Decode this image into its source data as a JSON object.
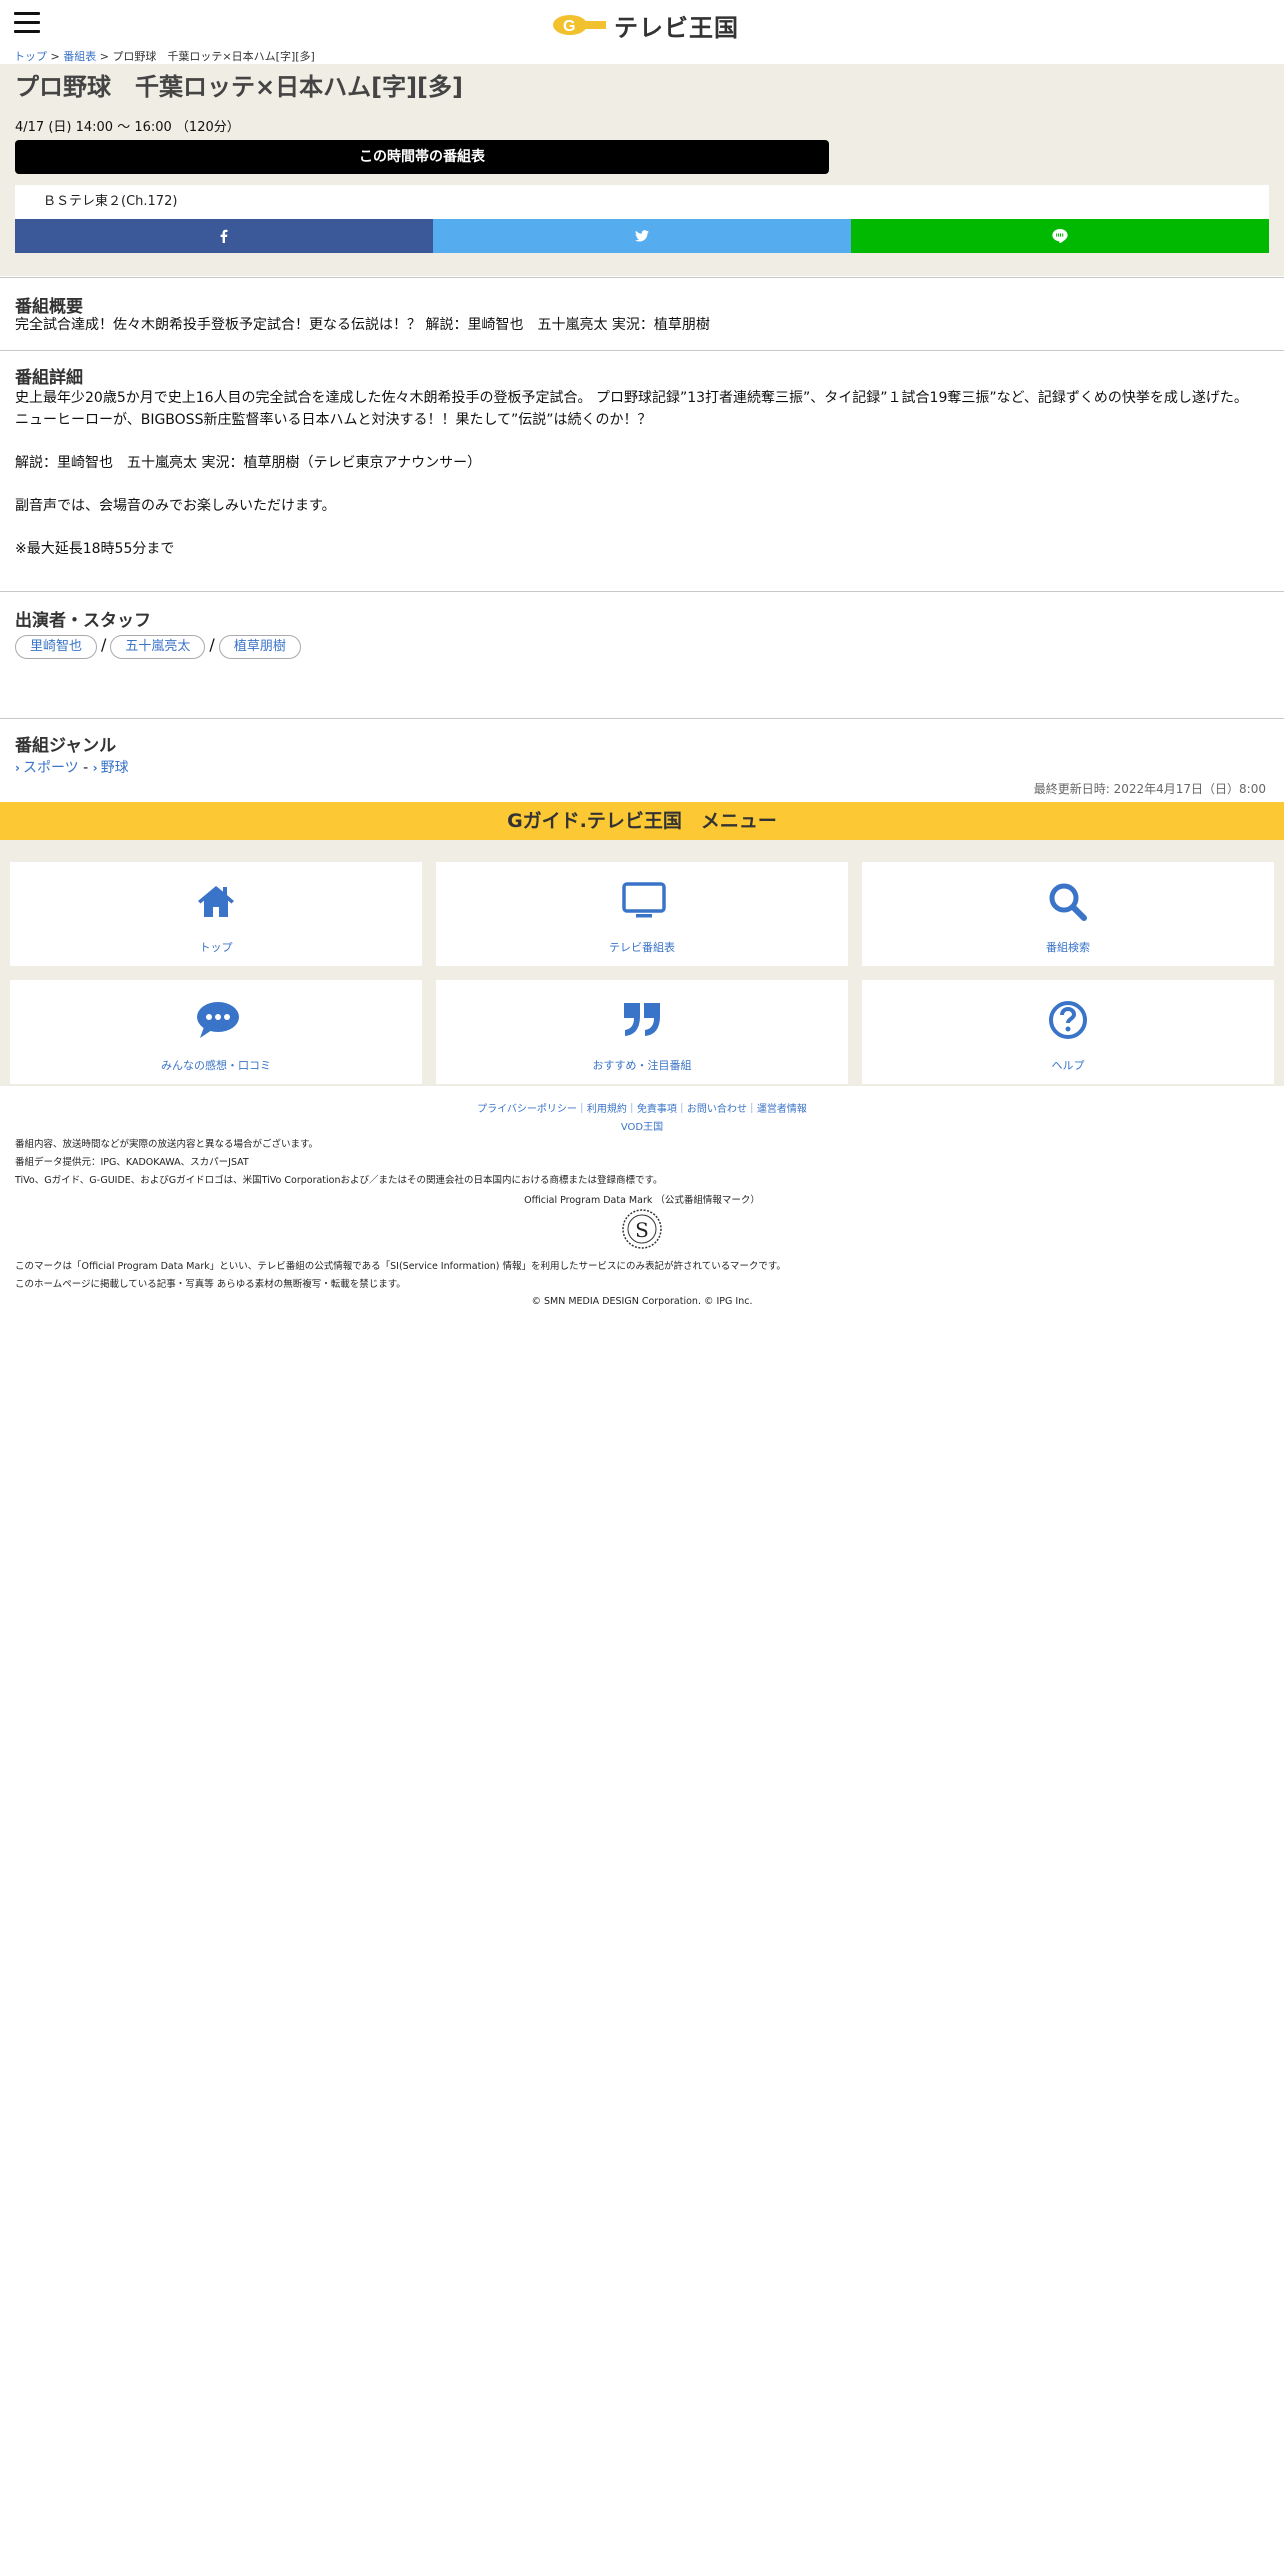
{
  "header": {
    "menu_icon": "hamburger-icon",
    "logo_text": "テレビ王国",
    "logo_mark_text": "G"
  },
  "breadcrumb": {
    "top": "トップ",
    "sep1": " > ",
    "guide": "番組表",
    "sep2": " > ",
    "current": "プロ野球　千葉ロッテ×日本ハム[字][多]"
  },
  "program": {
    "title": "プロ野球　千葉ロッテ×日本ハム[字][多]",
    "datetime": "4/17 (日) 14:00 ～ 16:00 （120分）",
    "timetable_button": "この時間帯の番組表",
    "channel": "ＢＳテレ東２(Ch.172)"
  },
  "share": {
    "facebook_icon": "facebook-icon",
    "twitter_icon": "twitter-icon",
    "line_icon": "line-icon",
    "colors": {
      "facebook": "#3b5998",
      "twitter": "#55acee",
      "line": "#00b900"
    }
  },
  "summary": {
    "heading": "番組概要",
    "text": "完全試合達成！佐々木朗希投手登板予定試合！更なる伝説は！？ 解説：里崎智也　五十嵐亮太 実況：植草朋樹"
  },
  "detail": {
    "heading": "番組詳細",
    "para1": "史上最年少20歳5か月で史上16人目の完全試合を達成した佐々木朗希投手の登板予定試合。 プロ野球記録”13打者連続奪三振”、タイ記録”１試合19奪三振”など、記録ずくめの快挙を成し遂げた。 ニューヒーローが、BIGBOSS新庄監督率いる日本ハムと対決する！！果たして”伝説”は続くのか！？",
    "para2": "解説：里崎智也　五十嵐亮太 実況：植草朋樹（テレビ東京アナウンサー）",
    "para3": "副音声では、会場音のみでお楽しみいただけます。",
    "para4": "※最大延長18時55分まで"
  },
  "cast": {
    "heading": "出演者・スタッフ",
    "sep": "/",
    "people": [
      "里崎智也",
      "五十嵐亮太",
      "植草朋樹"
    ]
  },
  "genre": {
    "heading": "番組ジャンル",
    "items": [
      "スポーツ",
      "野球"
    ],
    "sep": " - "
  },
  "updated": "最終更新日時: 2022年4月17日（日）8:00",
  "menu": {
    "title": "Gガイド.テレビ王国　メニュー",
    "accent": "#fcc934",
    "items": [
      {
        "label": "トップ",
        "icon": "home-icon"
      },
      {
        "label": "テレビ番組表",
        "icon": "tv-icon"
      },
      {
        "label": "番組検索",
        "icon": "search-icon"
      },
      {
        "label": "みんなの感想・口コミ",
        "icon": "comment-icon"
      },
      {
        "label": "おすすめ・注目番組",
        "icon": "quote-icon"
      },
      {
        "label": "ヘルプ",
        "icon": "help-icon"
      }
    ]
  },
  "footer": {
    "links": [
      "プライバシーポリシー",
      "利用規約",
      "免責事項",
      "お問い合わせ",
      "運営者情報"
    ],
    "link_sep": "｜",
    "vod": "VOD王国",
    "note1": "番組内容、放送時間などが実際の放送内容と異なる場合がございます。",
    "note2": "番組データ提供元：IPG、KADOKAWA、スカパーJSAT",
    "note3": "TiVo、Gガイド、G-GUIDE、およびGガイドロゴは、米国TiVo Corporationおよび／またはその関連会社の日本国内における商標または登録商標です。",
    "opd": "Official Program Data Mark （公式番組情報マーク）",
    "mark_letter": "S",
    "note4": "このマークは「Official Program Data Mark」といい、テレビ番組の公式情報である「SI(Service Information) 情報」を利用したサービスにのみ表記が許されているマークです。",
    "note5": "このホームページに掲載している記事・写真等 あらゆる素材の無断複写・転載を禁じます。",
    "copyright": "© SMN MEDIA DESIGN Corporation. © IPG Inc."
  }
}
